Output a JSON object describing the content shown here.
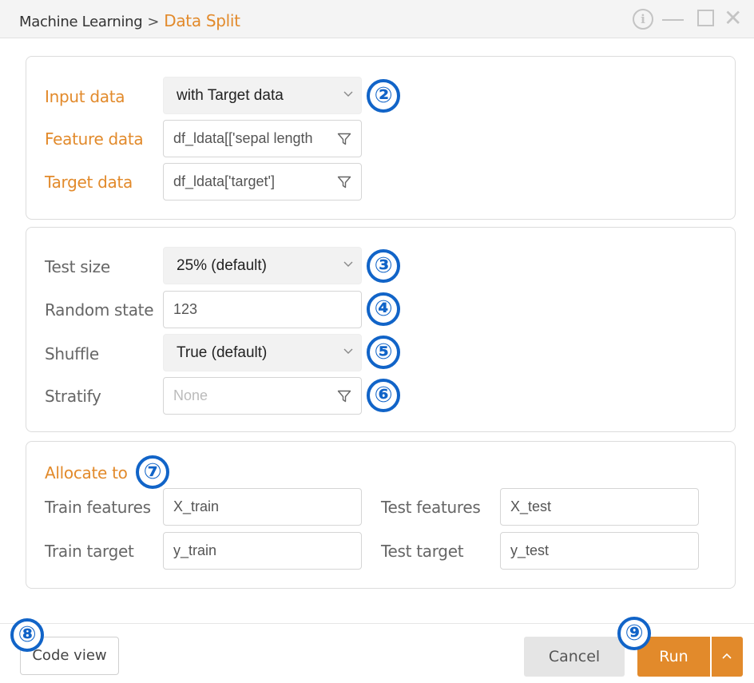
{
  "titlebar": {
    "breadcrumb_parent": "Machine Learning",
    "breadcrumb_separator": ">",
    "breadcrumb_current": "Data Split",
    "info_icon": "i"
  },
  "data_section": {
    "input_data_label": "Input data",
    "input_data_value": "with Target data",
    "feature_data_label": "Feature data",
    "feature_data_value": "df_ldata[['sepal length",
    "target_data_label": "Target data",
    "target_data_value": "df_ldata['target']"
  },
  "options_section": {
    "test_size_label": "Test size",
    "test_size_value": "25% (default)",
    "random_state_label": "Random state",
    "random_state_value": "123",
    "shuffle_label": "Shuffle",
    "shuffle_value": "True (default)",
    "stratify_label": "Stratify",
    "stratify_placeholder": "None"
  },
  "allocate_section": {
    "title": "Allocate to",
    "train_features_label": "Train features",
    "train_features_value": "X_train",
    "test_features_label": "Test features",
    "test_features_value": "X_test",
    "train_target_label": "Train target",
    "train_target_value": "y_train",
    "test_target_label": "Test target",
    "test_target_value": "y_test"
  },
  "footer": {
    "code_view_label": "Code view",
    "cancel_label": "Cancel",
    "run_label": "Run"
  },
  "badges": [
    "②",
    "③",
    "④",
    "⑤",
    "⑥",
    "⑦",
    "⑧",
    "⑨"
  ],
  "colors": {
    "accent": "#e28a2b",
    "badge_blue": "#1164c8"
  }
}
